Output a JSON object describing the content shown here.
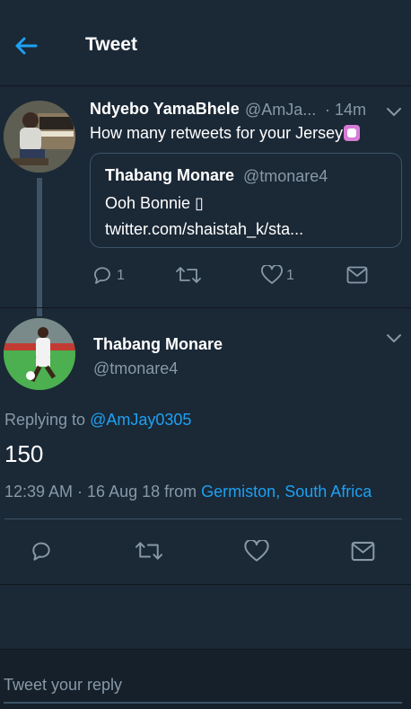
{
  "header": {
    "title": "Tweet"
  },
  "quoting_tweet": {
    "author_name": "Ndyebo YamaBhele",
    "author_handle": "@AmJa...",
    "time": "· 14m",
    "text": "How many retweets for your Jersey",
    "quoted": {
      "author_name": "Thabang Monare",
      "author_handle": "@tmonare4",
      "text": "Ooh Bonnie ▯ twitter.com/shaistah_k/sta..."
    },
    "reply_count": "1",
    "like_count": "1"
  },
  "main_tweet": {
    "author_name": "Thabang Monare",
    "author_handle": "@tmonare4",
    "replying_prefix": "Replying to",
    "replying_to": "@AmJay0305",
    "text": "150",
    "timestamp": "12:39 AM · 16 Aug 18",
    "from_prefix": "from",
    "location": "Germiston, South Africa"
  },
  "reply_box": {
    "placeholder": "Tweet your reply"
  },
  "colors": {
    "background": "#1b2836",
    "accent": "#1da1f2",
    "muted": "#8899a6",
    "border": "#3d5466"
  }
}
